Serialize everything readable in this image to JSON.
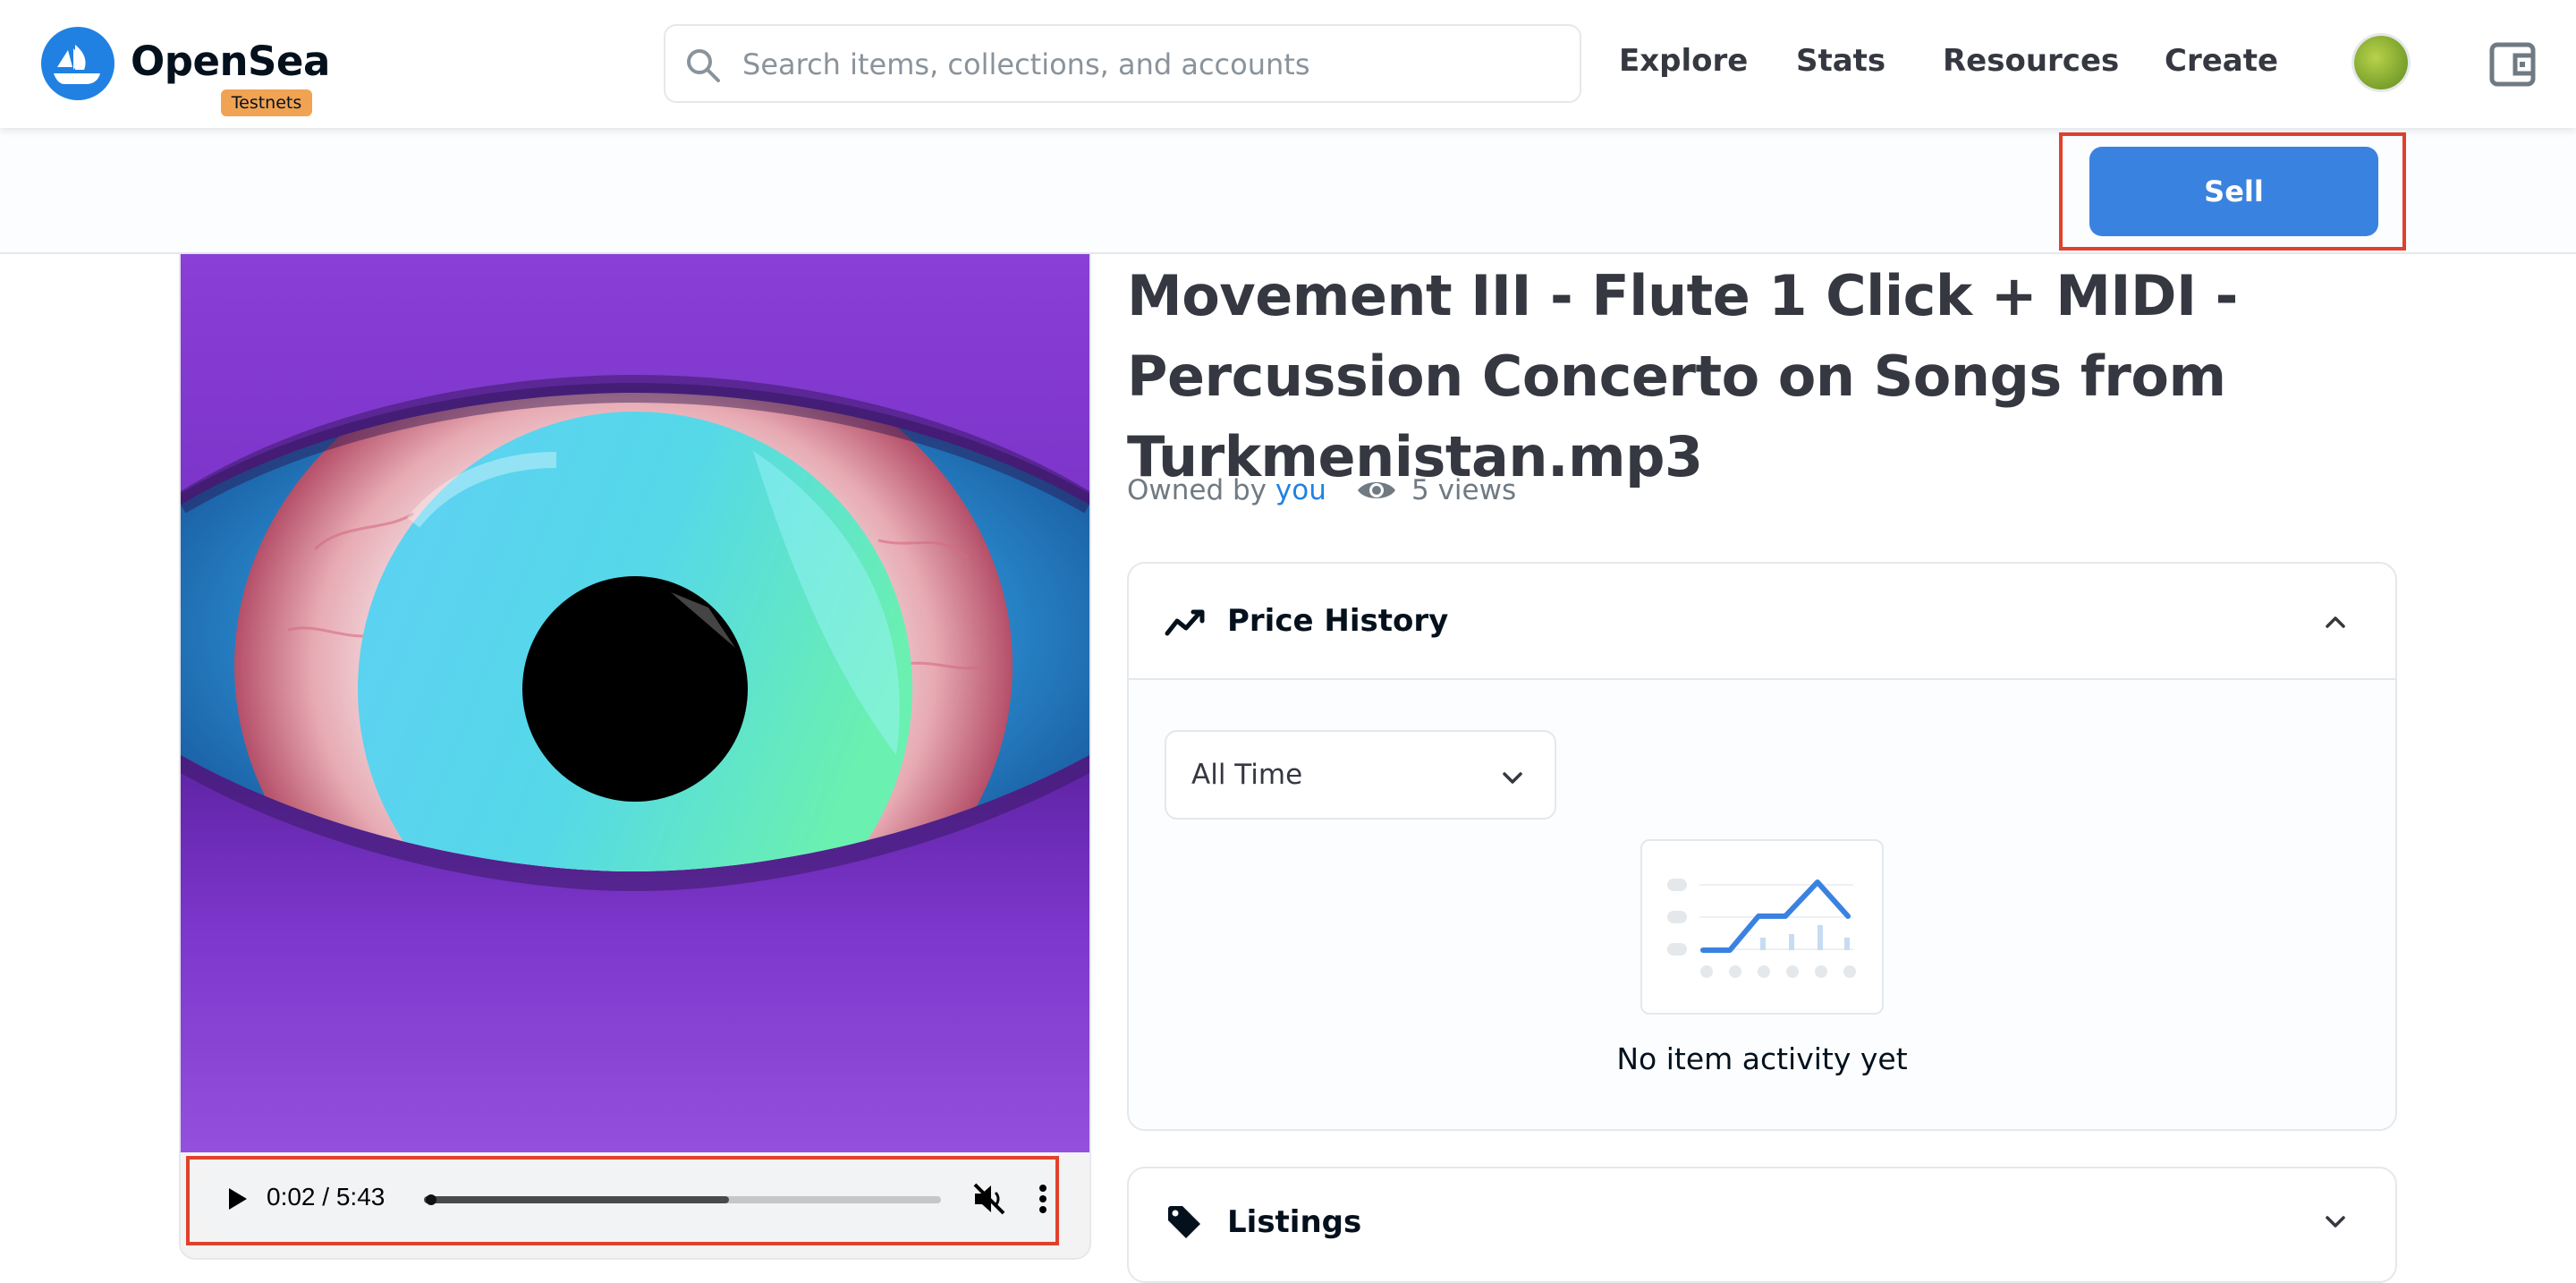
{
  "header": {
    "brand": "OpenSea",
    "badge": "Testnets",
    "search_placeholder": "Search items, collections, and accounts",
    "nav": [
      "Explore",
      "Stats",
      "Resources",
      "Create"
    ],
    "icons": {
      "logo": "opensea-logo-icon",
      "search": "search-icon",
      "avatar": "profile-avatar",
      "wallet": "wallet-icon"
    }
  },
  "actions": {
    "sell_label": "Sell"
  },
  "player": {
    "current_time": "0:02",
    "separator": " / ",
    "duration": "5:43",
    "progress_fraction": 0.003,
    "buffered_fraction": 0.59,
    "icons": {
      "play": "play-icon",
      "mute": "muted-speaker-icon",
      "more": "more-vertical-icon"
    }
  },
  "item": {
    "title": "Movement III - Flute 1 Click + MIDI - Percussion Concerto on Songs from Turkmenistan.mp3",
    "owned_prefix": "Owned by ",
    "owner": "you",
    "views": "5 views"
  },
  "price_history": {
    "title": "Price History",
    "range_value": "All Time",
    "empty_text": "No item activity yet",
    "icons": {
      "header": "trending-line-icon",
      "collapse": "chevron-up-icon",
      "select": "chevron-down-icon"
    }
  },
  "listings": {
    "title": "Listings",
    "icons": {
      "header": "tag-icon",
      "expand": "chevron-down-icon"
    }
  },
  "colors": {
    "accent": "#2081e2",
    "sell_button": "#3a82e0",
    "highlight_box": "#e0412c",
    "badge": "#f0a353",
    "artwork_background": "#8a3fd6"
  }
}
